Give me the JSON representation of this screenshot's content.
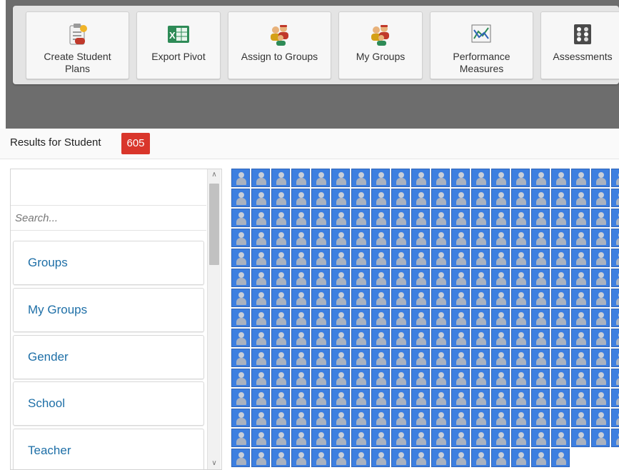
{
  "toolbar": {
    "buttons": [
      {
        "label": "Create Student\nPlans",
        "icon": "clipboard-edit-icon"
      },
      {
        "label": "Export Pivot",
        "icon": "excel-export-icon"
      },
      {
        "label": "Assign to Groups",
        "icon": "people-group-icon"
      },
      {
        "label": "My Groups",
        "icon": "people-group-icon"
      },
      {
        "label": "Performance\nMeasures",
        "icon": "line-chart-icon"
      },
      {
        "label": "Assessments",
        "icon": "assessment-grid-icon"
      }
    ]
  },
  "results": {
    "label": "Results for Student",
    "count": "605"
  },
  "filter_panel": {
    "search_placeholder": "Search...",
    "items": [
      {
        "label": "Groups"
      },
      {
        "label": "My Groups"
      },
      {
        "label": "Gender"
      },
      {
        "label": "School"
      },
      {
        "label": "Teacher"
      }
    ]
  },
  "student_grid": {
    "tile_icon": "student-avatar-icon",
    "tile_color": "#3d7fe0",
    "visible_full_rows": 14,
    "last_row_count": 17
  },
  "colors": {
    "toolbar_background": "#6d6d6d",
    "badge": "#d9362b",
    "link": "#1e6fa7"
  }
}
